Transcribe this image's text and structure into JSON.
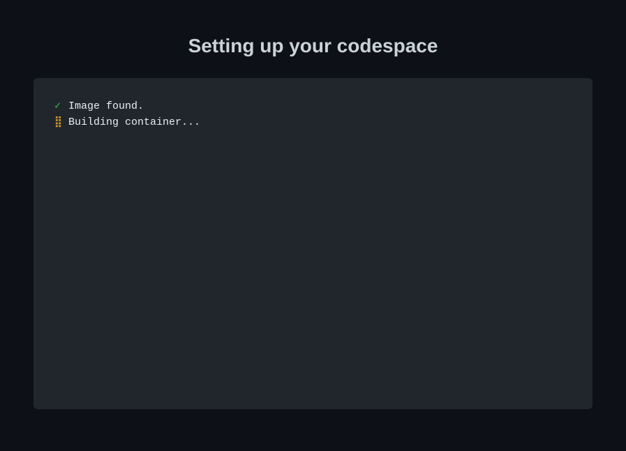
{
  "header": {
    "title": "Setting up your codespace"
  },
  "terminal": {
    "lines": [
      {
        "icon": "check",
        "iconGlyph": "✓",
        "text": "Image found."
      },
      {
        "icon": "spinner",
        "iconGlyph": "⣿",
        "text": "Building container..."
      }
    ]
  },
  "colors": {
    "background": "#0d1117",
    "panelBackground": "#21262d",
    "textPrimary": "#c9d1d9",
    "textTerminal": "#e6edf3",
    "success": "#3fb950",
    "warning": "#d29922"
  }
}
